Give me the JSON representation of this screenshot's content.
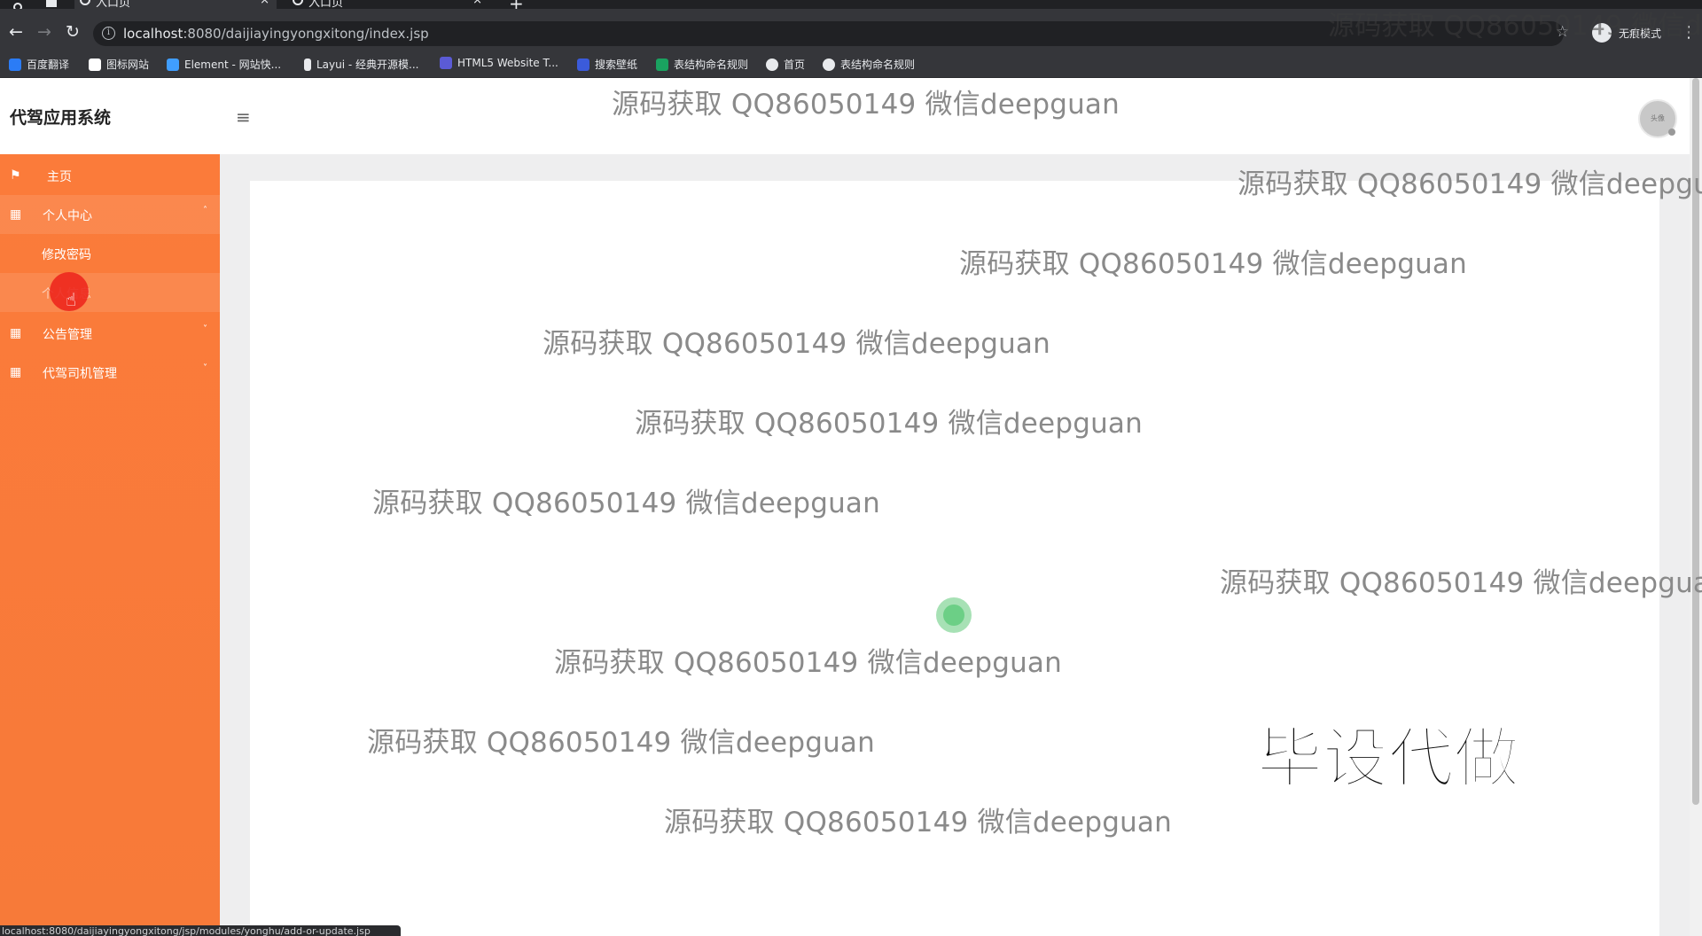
{
  "browser": {
    "tabs": [
      {
        "title": "入口页",
        "active": true
      },
      {
        "title": "入口页",
        "active": false
      }
    ],
    "url_host": "localhost",
    "url_rest": ":8080/daijiayingyongxitong/index.jsp",
    "incognito_label": "无痕模式",
    "bookmarks": [
      {
        "label": "百度翻译",
        "color": "#2b7cf6"
      },
      {
        "label": "图标网站",
        "color": "#ffffff"
      },
      {
        "label": "Element - 网站快...",
        "color": "#409eff"
      },
      {
        "label": "Layui - 经典开源模...",
        "color": "#e8eaed"
      },
      {
        "label": "HTML5 Website T...",
        "color": "#5b5bd6"
      },
      {
        "label": "搜索壁纸",
        "color": "#3b5bdb"
      },
      {
        "label": "表结构命名规则",
        "color": "#1aa260"
      },
      {
        "label": "首页",
        "color": "#e8eaed"
      },
      {
        "label": "表结构命名规则",
        "color": "#e8eaed"
      }
    ],
    "status_url": "localhost:8080/daijiayingyongxitong/jsp/modules/yonghu/add-or-update.jsp"
  },
  "app": {
    "brand": "代驾应用系统",
    "avatar_text": "头像",
    "sidebar": {
      "home": "主页",
      "personal_center": "个人中心",
      "change_password": "修改密码",
      "personal_info": "个人信息",
      "notice_mgmt": "公告管理",
      "driver_mgmt": "代驾司机管理"
    }
  },
  "watermarks": {
    "text": "源码获取 QQ86050149 微信deepguan",
    "corner_text": "源码获取 QQ86050149 微信de",
    "stamp": "毕设代做"
  },
  "colors": {
    "sidebar": "#fb7b3a",
    "chrome_dark": "#35363a"
  }
}
